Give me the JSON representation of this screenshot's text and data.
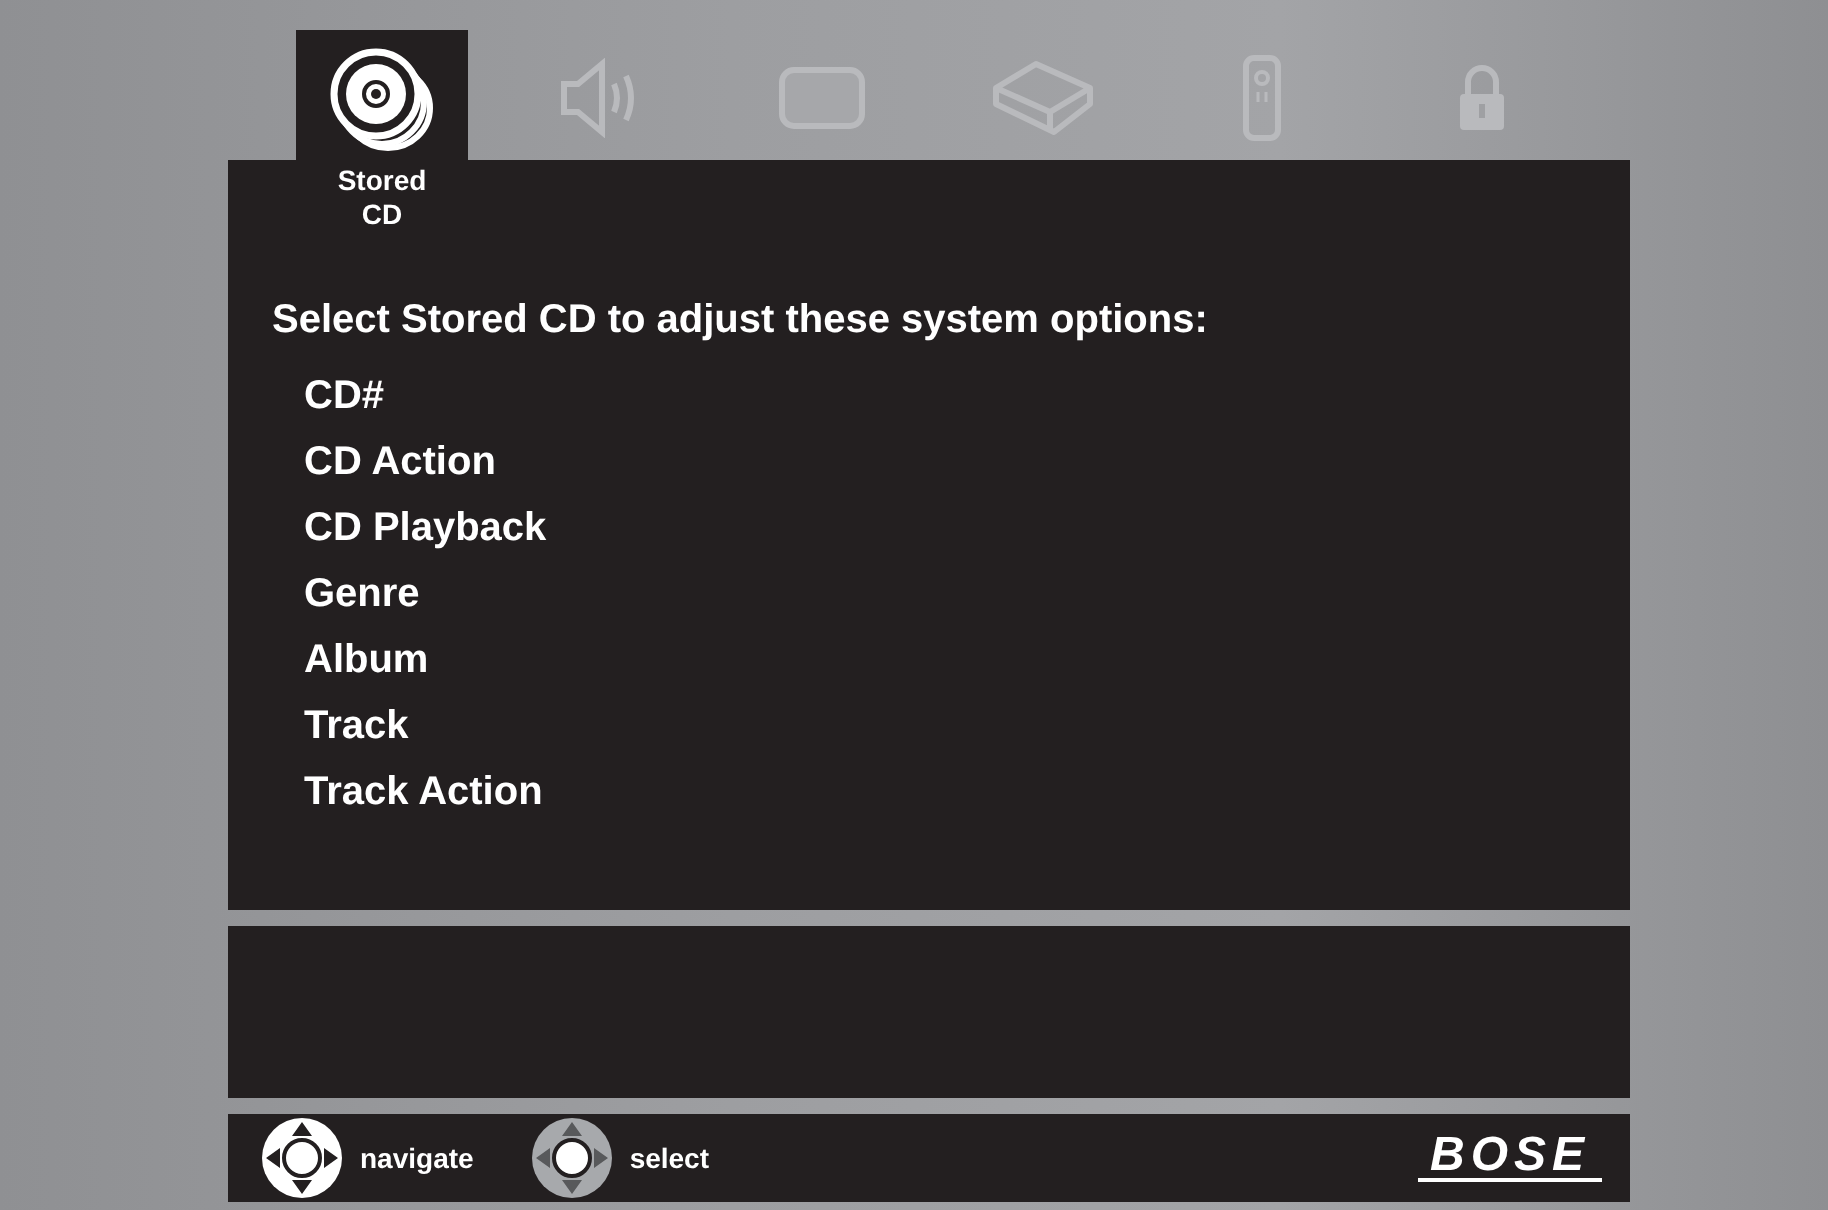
{
  "tabs": [
    {
      "kind": "cd",
      "label": "Stored CD",
      "selected": true
    },
    {
      "kind": "speaker",
      "selected": false
    },
    {
      "kind": "tv",
      "selected": false
    },
    {
      "kind": "box",
      "selected": false
    },
    {
      "kind": "remote",
      "selected": false
    },
    {
      "kind": "lock",
      "selected": false
    }
  ],
  "heading": "Select Stored CD to adjust these system options:",
  "options": [
    "CD#",
    "CD Action",
    "CD Playback",
    "Genre",
    "Album",
    "Track",
    "Track Action"
  ],
  "hints": [
    {
      "kind": "navigate",
      "label": "navigate"
    },
    {
      "kind": "select",
      "label": "select"
    }
  ],
  "logo": "BOSE"
}
